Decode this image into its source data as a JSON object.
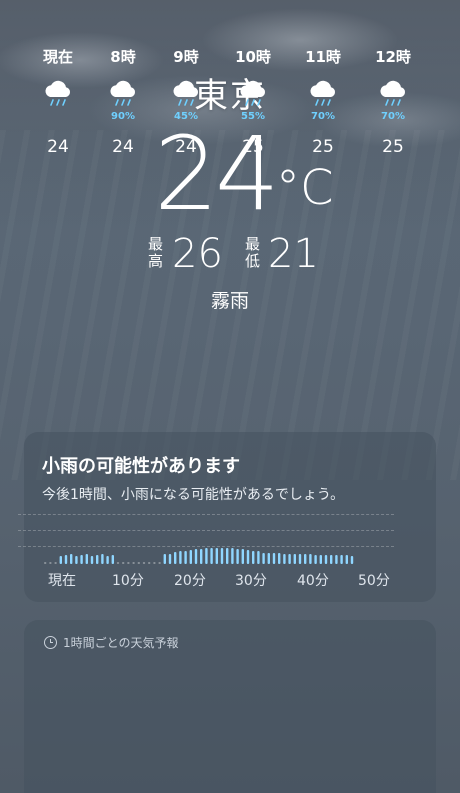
{
  "location": {
    "city": "東京",
    "temperature": "24",
    "unit": "°C",
    "high_label": "最高",
    "high": "26",
    "low_label": "最低",
    "low": "21",
    "condition": "霧雨"
  },
  "precip_card": {
    "title": "小雨の可能性があります",
    "subtitle": "今後1時間、小雨になる可能性があるでしょう。",
    "axis": [
      "現在",
      "10分",
      "20分",
      "30分",
      "40分",
      "50分"
    ],
    "bar_color": "#8fd6ff"
  },
  "hourly_card": {
    "title": "1時間ごとの天気予報",
    "hours": [
      {
        "label": "現在",
        "pop": "",
        "temp": "24",
        "icon": "cloud-rain-icon"
      },
      {
        "label": "8時",
        "pop": "90%",
        "temp": "24",
        "icon": "cloud-rain-icon"
      },
      {
        "label": "9時",
        "pop": "45%",
        "temp": "24",
        "icon": "cloud-rain-icon"
      },
      {
        "label": "10時",
        "pop": "55%",
        "temp": "25",
        "icon": "cloud-rain-icon"
      },
      {
        "label": "11時",
        "pop": "70%",
        "temp": "25",
        "icon": "cloud-rain-icon"
      },
      {
        "label": "12時",
        "pop": "70%",
        "temp": "25",
        "icon": "cloud-rain-icon"
      }
    ]
  }
}
